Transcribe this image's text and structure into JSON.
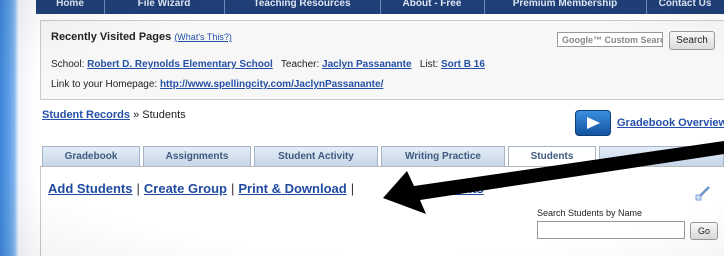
{
  "nav": {
    "items": [
      "Home",
      "File Wizard",
      "Teaching Resources",
      "About - Free",
      "Premium Membership",
      "Contact Us"
    ]
  },
  "recent": {
    "title": "Recently Visited Pages",
    "whats_this": "(What's This?)",
    "search_placeholder": "Google™ Custom Search",
    "search_button": "Search",
    "school_label": "School:",
    "school_name": "Robert D. Reynolds Elementary School",
    "teacher_label": "Teacher:",
    "teacher_name": "Jaclyn Passanante",
    "list_label": "List:",
    "list_name": "Sort B 16",
    "homepage_label": "Link to your Homepage:",
    "homepage_url": "http://www.spellingcity.com/JaclynPassanante/"
  },
  "breadcrumb": {
    "root": "Student Records",
    "separator": "»",
    "current": "Students"
  },
  "gradebook_overview": "Gradebook Overview",
  "tabs": [
    "Gradebook",
    "Assignments",
    "Student Activity",
    "Writing Practice",
    "Students"
  ],
  "active_tab": "Students",
  "actions": {
    "add_students": "Add Students",
    "create_group": "Create Group",
    "print_download": "Print & Download",
    "fourth": "Students",
    "separator": "|"
  },
  "student_search": {
    "label": "Search Students by Name",
    "button": "Go"
  },
  "colors": {
    "nav_bg": "#1f3f77",
    "link": "#2450a8",
    "tab_bg": "#c5d6e8",
    "annotation_arrow": "#000000"
  },
  "icons": [
    "video-play-icon",
    "edit-pencil-icon"
  ]
}
